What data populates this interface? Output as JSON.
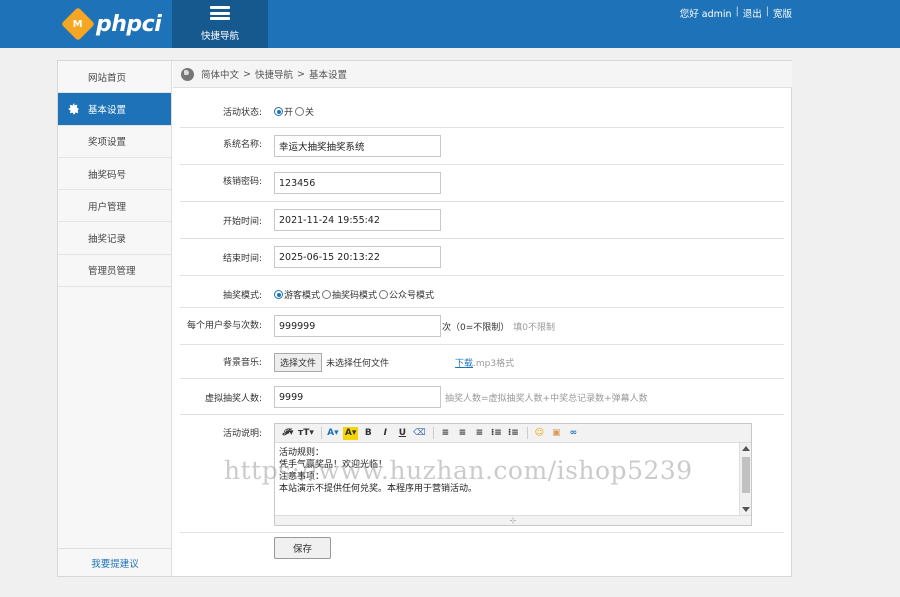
{
  "header": {
    "logo_mark": "M",
    "logo_text": "phpci",
    "nav_tab_label": "快捷导航",
    "greeting": "您好 admin",
    "logout": "退出",
    "home": "宽版"
  },
  "sidebar": {
    "items": [
      {
        "label": "网站首页"
      },
      {
        "label": "基本设置"
      },
      {
        "label": "奖项设置"
      },
      {
        "label": "抽奖码号"
      },
      {
        "label": "用户管理"
      },
      {
        "label": "抽奖记录"
      },
      {
        "label": "管理员管理"
      }
    ],
    "active_index": 1,
    "bottom_link": "我要提建议"
  },
  "breadcrumb": {
    "items": [
      "简体中文",
      "快捷导航",
      "基本设置"
    ],
    "separator": ">"
  },
  "form": {
    "status": {
      "label": "活动状态:",
      "options": [
        "开",
        "关"
      ],
      "selected": "开"
    },
    "system_name": {
      "label": "系统名称:",
      "value": "幸运大抽奖抽奖系统"
    },
    "verify_code": {
      "label": "核销密码:",
      "value": "123456"
    },
    "start_time": {
      "label": "开始时间:",
      "value": "2021-11-24 19:55:42"
    },
    "end_time": {
      "label": "结束时间:",
      "value": "2025-06-15 20:13:22"
    },
    "draw_mode": {
      "label": "抽奖模式:",
      "options": [
        "游客模式",
        "抽奖码模式",
        "公众号模式"
      ],
      "selected": "游客模式"
    },
    "times_per_user": {
      "label": "每个用户参与次数:",
      "value": "999999",
      "unit": "次（0=不限制）",
      "hint": "填0不限制"
    },
    "bg_music": {
      "label": "背景音乐:",
      "button": "选择文件",
      "status": "未选择任何文件",
      "download": "下载",
      "hint": ".mp3格式"
    },
    "virtual_count": {
      "label": "虚拟抽奖人数:",
      "value": "9999",
      "hint": "抽奖人数=虚拟抽奖人数+中奖总记录数+弹幕人数"
    },
    "description": {
      "label": "活动说明:",
      "lines": [
        "活动规则：",
        "凭手气赢奖品！欢迎光临！",
        "注意事项：",
        "本站演示不提供任何兑奖。本程序用于营销活动。"
      ]
    },
    "save": "保存"
  },
  "toolbar_icons": [
    "font-family-icon",
    "font-size-icon",
    "font-color-icon",
    "highlight-icon",
    "bold-icon",
    "italic-icon",
    "underline-icon",
    "eraser-icon",
    "align-left-icon",
    "align-center-icon",
    "align-right-icon",
    "ordered-list-icon",
    "unordered-list-icon",
    "emoticon-icon",
    "image-icon",
    "link-icon"
  ],
  "watermark": "https://www.huzhan.com/ishop5239",
  "colors": {
    "header": "#1e73b8",
    "nav_tab": "#16598f",
    "active": "#1e73b8",
    "logo_badge": "#f5a623"
  }
}
